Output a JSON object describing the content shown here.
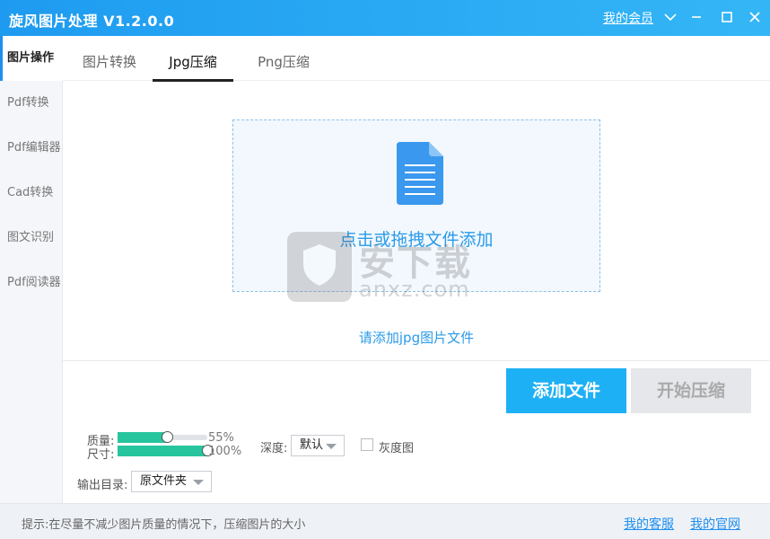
{
  "window": {
    "title": "旋风图片处理 V1.2.0.0",
    "member_link": "我的会员"
  },
  "sidebar": {
    "items": [
      {
        "label": "图片操作",
        "active": true
      },
      {
        "label": "Pdf转换",
        "active": false
      },
      {
        "label": "Pdf编辑器",
        "active": false
      },
      {
        "label": "Cad转换",
        "active": false
      },
      {
        "label": "图文识别",
        "active": false
      },
      {
        "label": "Pdf阅读器",
        "active": false
      }
    ]
  },
  "tabs": [
    {
      "label": "图片转换",
      "active": false
    },
    {
      "label": "Jpg压缩",
      "active": true
    },
    {
      "label": "Png压缩",
      "active": false
    }
  ],
  "dropzone": {
    "text": "点击或拖拽文件添加",
    "hint": "请添加jpg图片文件"
  },
  "watermark": {
    "big": "安下载",
    "small": "anxz.com"
  },
  "actions": {
    "add_label": "添加文件",
    "start_label": "开始压缩"
  },
  "settings": {
    "quality_label": "质量:",
    "quality_value": 55,
    "quality_text": "55%",
    "size_label": "尺寸:",
    "size_value": 100,
    "size_text": "100%",
    "depth_label": "深度:",
    "depth_value": "默认",
    "grayscale_label": "灰度图",
    "grayscale_checked": false,
    "output_label": "输出目录:",
    "output_value": "原文件夹"
  },
  "footer": {
    "tip": "提示:在尽量不减少图片质量的情况下，压缩图片的大小",
    "service_link": "我的客服",
    "website_link": "我的官网"
  },
  "colors": {
    "accent": "#1eb0f5",
    "titlebar": "#1e9bf0",
    "slider_fill": "#27c59d",
    "link": "#1d8ff0"
  }
}
